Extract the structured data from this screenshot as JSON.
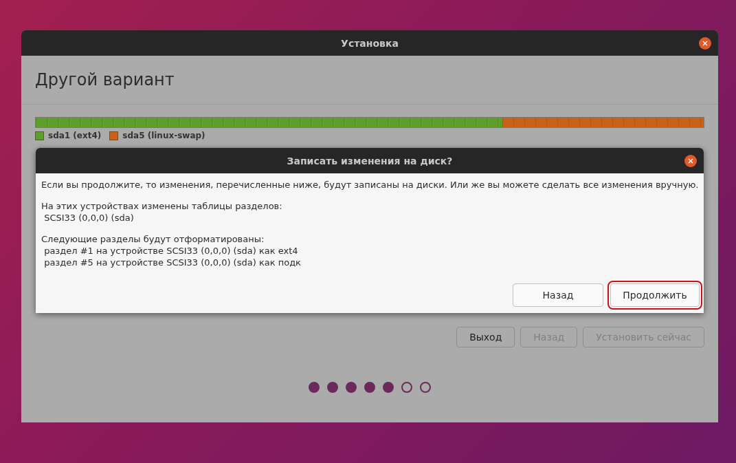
{
  "window": {
    "title": "Установка"
  },
  "page_title": "Другой вариант",
  "partitions": [
    {
      "label": "sda1 (ext4)",
      "color": "#5f9e2a",
      "level": 0.699
    },
    {
      "label": "sda5 (linux-swap)",
      "color": "#c8621a",
      "level": 0.301
    }
  ],
  "buttons": [
    {
      "label": "Выход",
      "disabled": false
    },
    {
      "label": "Назад",
      "disabled": true
    },
    {
      "label": "Установить сейчас",
      "disabled": true
    }
  ],
  "progress_dots": [
    {
      "filled": true
    },
    {
      "filled": true
    },
    {
      "filled": true
    },
    {
      "filled": true
    },
    {
      "filled": true
    },
    {
      "filled": false
    },
    {
      "filled": false
    }
  ],
  "dialog": {
    "title": "Записать изменения на диск?",
    "paragraphs": [
      [
        "Если вы продолжите, то изменения, перечисленные ниже, будут записаны на диски. Или же вы можете сделать все изменения вручную."
      ],
      [
        "На этих устройствах изменены таблицы разделов:",
        " SCSI33 (0,0,0) (sda)"
      ],
      [
        "Следующие разделы будут отформатированы:",
        " раздел #1 на устройстве SCSI33 (0,0,0) (sda) как ext4",
        " раздел #5 на устройстве SCSI33 (0,0,0) (sda) как подк"
      ]
    ],
    "buttons": [
      {
        "label": "Назад",
        "highlighted": false
      },
      {
        "label": "Продолжить",
        "highlighted": true
      }
    ]
  }
}
